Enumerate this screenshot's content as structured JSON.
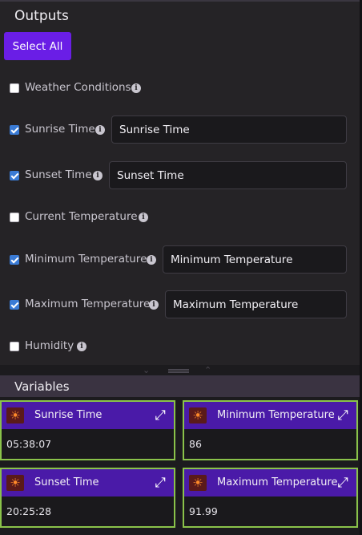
{
  "outputs": {
    "title": "Outputs",
    "select_all_label": "Select All",
    "items": [
      {
        "label": "Weather Conditions",
        "checked": false,
        "value": null
      },
      {
        "label": "Sunrise Time",
        "checked": true,
        "value": "Sunrise Time"
      },
      {
        "label": "Sunset Time",
        "checked": true,
        "value": "Sunset Time"
      },
      {
        "label": "Current Temperature",
        "checked": false,
        "value": null
      },
      {
        "label": "Minimum Temperature",
        "checked": true,
        "value": "Minimum Temperature"
      },
      {
        "label": "Maximum Temperature",
        "checked": true,
        "value": "Maximum Temperature"
      },
      {
        "label": "Humidity",
        "checked": false,
        "value": null
      }
    ]
  },
  "variables": {
    "title": "Variables",
    "cards": [
      {
        "name": "Sunrise Time",
        "value": "05:38:07",
        "icon": "sun-icon"
      },
      {
        "name": "Minimum Temperature",
        "value": "86",
        "icon": "sun-icon"
      },
      {
        "name": "Sunset Time",
        "value": "20:25:28",
        "icon": "sun-icon"
      },
      {
        "name": "Maximum Temperature",
        "value": "91.99",
        "icon": "sun-icon"
      }
    ]
  },
  "colors": {
    "accent": "#6a1ee6",
    "card_header": "#4a1aa8",
    "card_border": "#8ac24a",
    "checkbox_checked": "#3a7bd5"
  }
}
